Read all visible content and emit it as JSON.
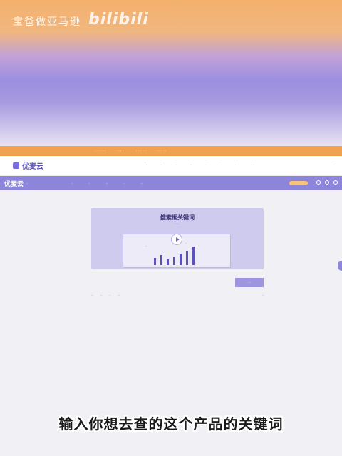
{
  "banner": {
    "channel": "宝爸做亚马逊",
    "site": "bilibili"
  },
  "brand": {
    "name": "优麦云",
    "accent": "#8d85d9",
    "orange": "#f1a150"
  },
  "app": {
    "logo": "优麦云",
    "hero_title": "搜索框关键词"
  },
  "caption": "输入你想去查的这个产品的关键词"
}
